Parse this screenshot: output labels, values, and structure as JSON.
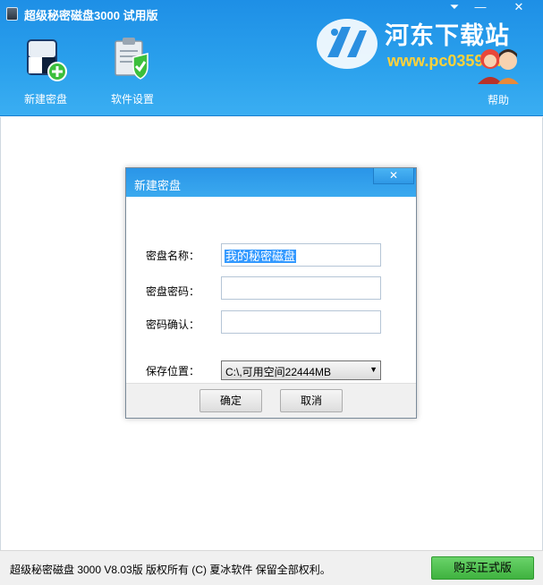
{
  "window": {
    "title": "超级秘密磁盘3000 试用版",
    "menu_glyph": "⏷",
    "minimize_glyph": "—",
    "close_glyph": "✕"
  },
  "watermark": {
    "title": "河东下载站",
    "url": "www.pc0359.cn"
  },
  "toolbar": {
    "new_disk_label": "新建密盘",
    "settings_label": "软件设置",
    "help_label": "帮助",
    "new_disk_icon": "new-disk-icon",
    "settings_icon": "clipboard-check-icon"
  },
  "dialog": {
    "title": "新建密盘",
    "close_glyph": "✕",
    "fields": {
      "name_label": "密盘名称：",
      "name_value": "我的秘密磁盘",
      "password_label": "密盘密码：",
      "password_value": "",
      "confirm_label": "密码确认：",
      "confirm_value": "",
      "location_label": "保存位置：",
      "location_value": "C:\\,可用空间22444MB"
    },
    "ok_label": "确定",
    "cancel_label": "取消"
  },
  "statusbar": {
    "copyright": "超级秘密磁盘 3000 V8.03版  版权所有 (C)  夏冰软件 保留全部权利。",
    "buy_label": "购买正式版"
  },
  "colors": {
    "header_blue": "#2aa0ec",
    "buy_green": "#4cc24c",
    "selection": "#3399ff"
  }
}
